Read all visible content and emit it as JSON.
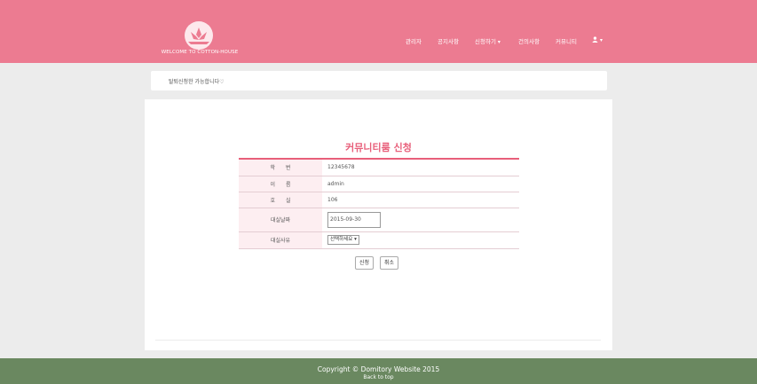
{
  "header": {
    "logo_text": "WELCOME TO COTTON-HOUSE",
    "nav": [
      {
        "label": "관리자"
      },
      {
        "label": "공지사항"
      },
      {
        "label": "신청하기",
        "caret": "▾"
      },
      {
        "label": "건의사항"
      },
      {
        "label": "커뮤니티"
      }
    ],
    "user_caret": "▾"
  },
  "notice": {
    "text": "탈퇴신청한 가능합니다♡"
  },
  "form": {
    "title": "커뮤니티룸 신청",
    "rows": [
      {
        "label": "학　　번",
        "value": "12345678"
      },
      {
        "label": "이　　름",
        "value": "admin"
      },
      {
        "label": "호　　실",
        "value": "106"
      }
    ],
    "date_label": "대실날짜",
    "date_value": "2015-09-30",
    "reason_label": "대실사유",
    "reason_selected": "선택하세요",
    "submit_label": "신청",
    "cancel_label": "취소"
  },
  "footer": {
    "copyright": "Copyright © Domitory Website 2015",
    "back_to_top": "Back to top"
  },
  "colors": {
    "header": "#ec7b91",
    "accent": "#e85f7a",
    "footer": "#6a8860"
  }
}
